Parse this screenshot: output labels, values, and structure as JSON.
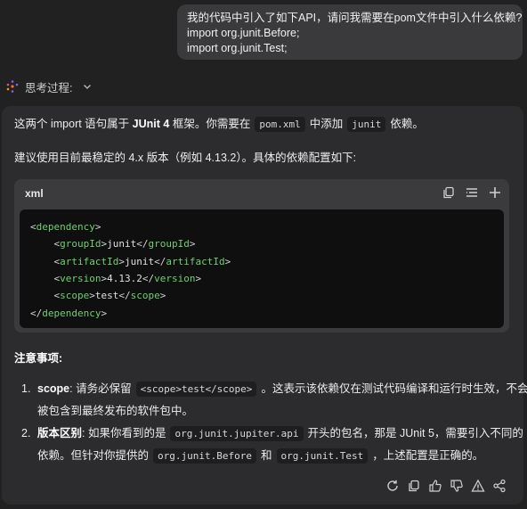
{
  "user_message": {
    "line1": "我的代码中引入了如下API，请问我需要在pom文件中引入什么依赖?",
    "line2": "import org.junit.Before;",
    "line3": "import org.junit.Test;"
  },
  "thinking": {
    "label": "思考过程:"
  },
  "answer": {
    "p1": {
      "a": "这两个 import 语句属于 ",
      "b": "JUnit 4",
      "c": " 框架。你需要在",
      "code1": "pom.xml",
      "d": "中添加",
      "code2": "junit",
      "e": "依赖。"
    },
    "p2": "建议使用目前最稳定的 4.x 版本（例如 4.13.2）。具体的依赖配置如下:",
    "code_block": {
      "lang": "xml",
      "lines": [
        {
          "indent": "",
          "open": "dependency",
          "text": "",
          "close": ""
        },
        {
          "indent": "    ",
          "open": "groupId",
          "text": "junit",
          "close": "groupId"
        },
        {
          "indent": "    ",
          "open": "artifactId",
          "text": "junit",
          "close": "artifactId"
        },
        {
          "indent": "    ",
          "open": "version",
          "text": "4.13.2",
          "close": "version"
        },
        {
          "indent": "    ",
          "open": "scope",
          "text": "test",
          "close": "scope"
        },
        {
          "indent": "",
          "open": "",
          "text": "",
          "close": "dependency"
        }
      ]
    },
    "notes_title": "注意事项:",
    "notes": [
      {
        "num": "1.",
        "label": "scope",
        "l1a": ": 请务必保留",
        "code": "<scope>test</scope>",
        "l1b": "。这表示该依赖仅在测试代码编译和运行时生效，不会",
        "l2": "被包含到最终发布的软件包中。"
      },
      {
        "num": "2.",
        "label": "版本区别",
        "l1a": ": 如果你看到的是",
        "code": "org.junit.jupiter.api",
        "l1b": "开头的包名，那是 JUnit 5，需要引入不同的",
        "l2a": "依赖。但针对你提供的",
        "code2": "org.junit.Before",
        "l2b": "和",
        "code3": "org.junit.Test",
        "l2c": "，上述配置是正确的。"
      }
    ]
  },
  "icons": {
    "code_tools": [
      "copy-icon",
      "wrap-icon",
      "expand-icon"
    ],
    "actions": [
      "regenerate-icon",
      "copy-icon",
      "thumbs-up-icon",
      "thumbs-down-icon",
      "warning-icon",
      "share-icon"
    ]
  }
}
